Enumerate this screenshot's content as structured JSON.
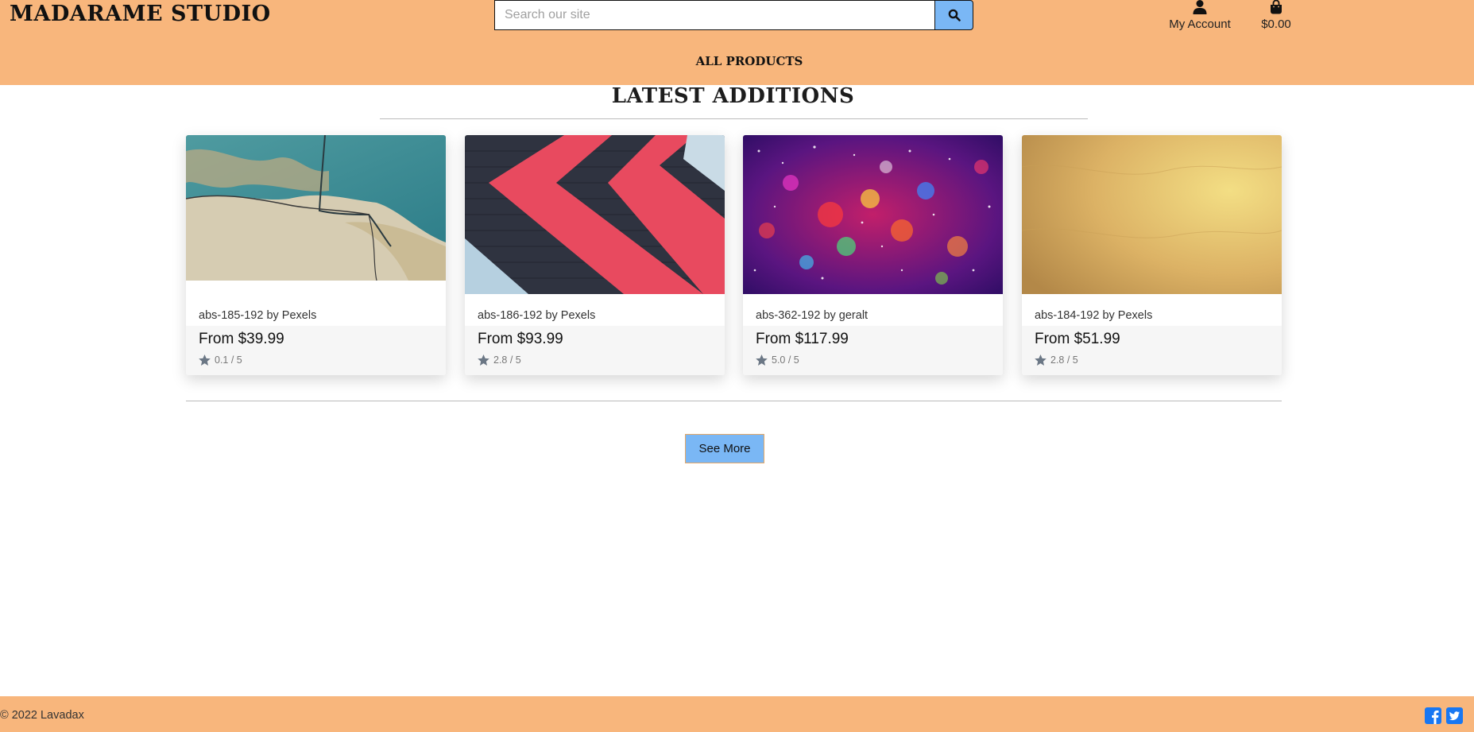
{
  "header": {
    "brand": "MADARAME STUDIO",
    "search_placeholder": "Search our site",
    "search_value": "",
    "account_label": "My Account",
    "cart_total": "$0.00",
    "nav_item": "ALL PRODUCTS"
  },
  "section": {
    "title": "LATEST ADDITIONS",
    "see_more_label": "See More"
  },
  "products": [
    {
      "name": "abs-185-192 by Pexels",
      "price": "From $39.99",
      "rating": "0.1 / 5"
    },
    {
      "name": "abs-186-192 by Pexels",
      "price": "From $93.99",
      "rating": "2.8 / 5"
    },
    {
      "name": "abs-362-192 by geralt",
      "price": "From $117.99",
      "rating": "5.0 / 5"
    },
    {
      "name": "abs-184-192 by Pexels",
      "price": "From $51.99",
      "rating": "2.8 / 5"
    }
  ],
  "footer": {
    "copyright": "© 2022 Lavadax"
  },
  "icons": {
    "search": "search-icon",
    "account": "user-icon",
    "cart": "shopping-bag-icon",
    "rating": "star-icon",
    "facebook": "facebook-icon",
    "twitter": "twitter-icon"
  },
  "colors": {
    "header_bg": "#f8b67c",
    "accent_button": "#7ab7f5",
    "social_blue": "#1877f2"
  }
}
